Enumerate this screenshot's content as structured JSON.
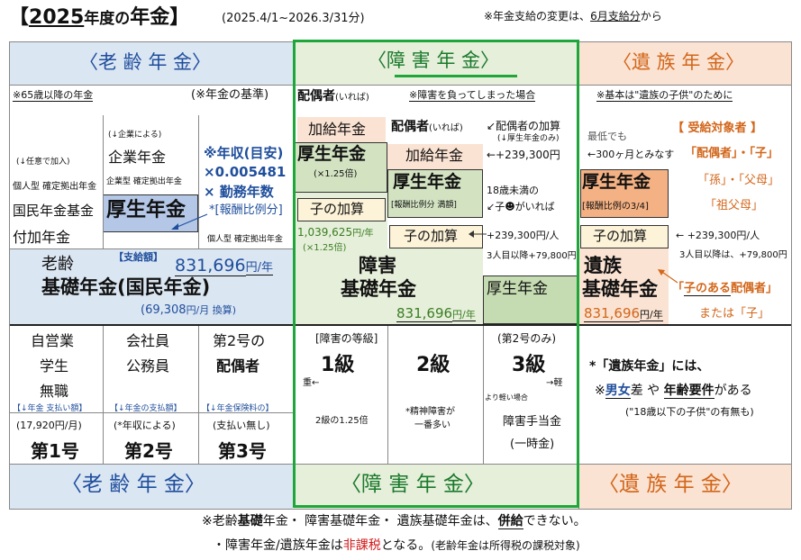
{
  "title": {
    "open": "【",
    "year": "2025",
    "year_unit": "年度",
    "no": "の",
    "main": "年金",
    "close": "】",
    "period": "(2025.4/1~2026.3/31分)",
    "note_pre": "※年金支給の変更は、",
    "note_hl": "6月支給分",
    "note_post": "から"
  },
  "header": {
    "left": "〈老 齢 年 金〉",
    "center": "〈障 害 年 金〉",
    "right": "〈遺 族 年 金〉"
  },
  "left": {
    "sub_note": "※65歳以降の年金",
    "basis": "(※年金の基準)",
    "col1_note": "(↓任意で加入)",
    "col1_r1": "個人型 確定拠出年金",
    "col1_r2": "国民年金基金",
    "col1_r3": "付加年金",
    "col2_note": "(↓企業による)",
    "col2_r1": "企業年金",
    "col2_r2": "企業型 確定拠出年金",
    "col2_r3": "厚生年金",
    "income_label": "※年収(目安)",
    "factor": "×0.005481",
    "years": "× 勤務年数",
    "ratio": "*[報酬比例分]",
    "col3_bottom": "個人型 確定拠出年金",
    "basic_l1": "老齢",
    "basic_l2": "基礎年金(国民年金)",
    "pay_label": "【支給額】",
    "pay_amount": "831,696",
    "pay_unit": "円/年",
    "month_amount": "(69,308",
    "month_unit": "円/月 換算)"
  },
  "center": {
    "spouse_only": "配偶者",
    "spouse_paren": "(いれば)",
    "note": "※障害を負ってしまった場合",
    "kakyu": "加給年金",
    "spouse2": "配偶者",
    "spouse2_paren": "(いれば)",
    "kakyu2": "加給年金",
    "kosei_a": "厚生年金",
    "kosei_a_note": "(×1.25倍)",
    "kosei_b": "厚生年金",
    "kosei_b_note": "[報酬比例分 満額]",
    "ko_kasan_a": "子の加算",
    "ko_kasan_b": "子の加算",
    "amount_a": "1,039,625",
    "amount_a_unit": "円/年",
    "amount_a_note": "(×1.25倍)",
    "disab_l1": "障害",
    "disab_l2": "基礎年金",
    "disab_amount": "831,696",
    "disab_unit": "円/年",
    "kosei_c": "厚生年金",
    "spouse_kakyu_title": "↙配偶者の加算",
    "spouse_kakyu_note": "(↓厚生年金のみ)",
    "spouse_kakyu_amt": "←+239,300円",
    "child_l1": "18歳未満の",
    "child_l2": "↙子",
    "child_l3": "がいれば",
    "child_amt": "+239,300円/人",
    "child_amt2": "3人目以降+79,800円",
    "grade_label": "[障害の等級]",
    "grade1": "1級",
    "grade2": "2級",
    "grade3_note": "(第2号のみ)",
    "grade3": "3級",
    "heavy": "重←",
    "light": "→軽",
    "lighter": "より軽い場合",
    "g1_note": "2級の1.25倍",
    "g2_note_l1": "*精神障害が",
    "g2_note_l2": "一番多い",
    "teate": "障害手当金",
    "teate_note": "(一時金)"
  },
  "right": {
    "note": "※基本は\"遺族の子供\"のために",
    "lowest": "最低でも",
    "months": "←300ヶ月とみなす",
    "target_title": "【 受給対象者 】",
    "t1": "「配偶者」・「子」",
    "t2": "「孫」・「父母」",
    "t3": "「祖父母」",
    "kosei": "厚生年金",
    "kosei_note": "[報酬比例の3/4]",
    "ko_kasan": "子の加算",
    "ko_amt": "← +239,300円/人",
    "ko_amt2": "3人目以降は、+79,800円",
    "izoku_l1": "遺族",
    "izoku_l2": "基礎年金",
    "izoku_amount": "831,696",
    "izoku_unit": "円/年",
    "has_child_pre": "「",
    "has_child_hl": "子のある",
    "has_child_post": "配偶者」",
    "or_child": "または「子」",
    "elig_l1": "*「遺族年金」には、",
    "elig_l2_a": "※",
    "elig_l2_b": "男女",
    "elig_l2_c": "差 や ",
    "elig_l2_d": "年齢要件",
    "elig_l2_e": "がある",
    "elig_l3": "(\"18歳以下の子供\"の有無も)"
  },
  "categories": [
    {
      "name_l1": "自営業",
      "name_l2": "学生",
      "name_l3": "無職",
      "pay_label": "【↓年金 支払い額】",
      "pay_val": "(17,920円/月)",
      "num": "第1号"
    },
    {
      "name_l1": "会社員",
      "name_l2": "公務員",
      "name_l3": "",
      "pay_label": "【↓年金の支払額】",
      "pay_val": "(*年収による)",
      "num": "第2号"
    },
    {
      "name_l1": "第2号の",
      "name_l2": "配偶者",
      "name_l3": "",
      "pay_label": "【↓年金保険料の】",
      "pay_val": "(支払い無し)",
      "num": "第3号"
    }
  ],
  "footer": {
    "l1_a": "※老齢",
    "l1_b": "基礎",
    "l1_c": "年金・ 障害基礎年金・ 遺族基礎年金は、",
    "l1_d": "併給",
    "l1_e": "できない。",
    "l2_a": "・障害年金/遺族年金は",
    "l2_b": "非課税",
    "l2_c": "となる。",
    "l2_d": "(老齢年金は所得税の課税対象)"
  },
  "colors": {
    "blue_band": "#dbe6f3",
    "green_band": "#e6efda",
    "orange_band": "#fbe3d3",
    "green_border": "#1fa63a",
    "accent_blue": "#1f4e9c",
    "accent_orange": "#d2661a"
  }
}
